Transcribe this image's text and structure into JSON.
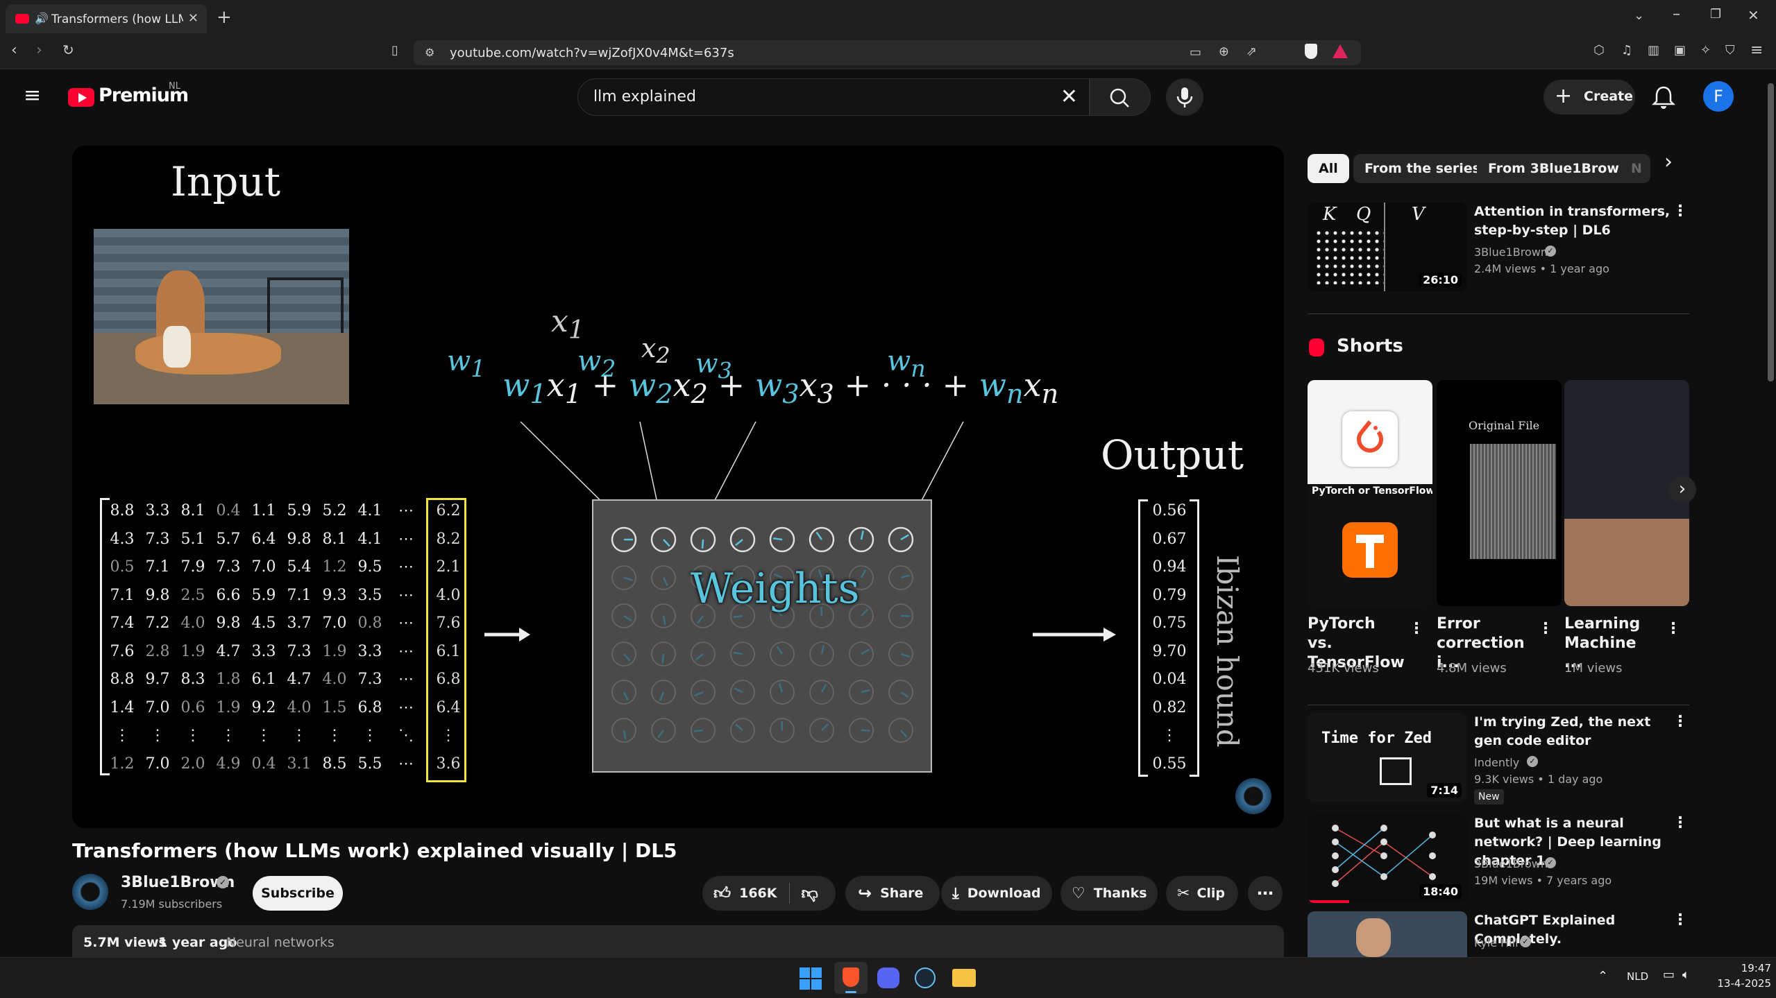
{
  "browser": {
    "tab_title": "Transformers (how LLMs wo",
    "url": "youtube.com/watch?v=wjZofJX0v4M&t=637s",
    "new_tab": "+",
    "icons": [
      "back-icon",
      "forward-icon",
      "reload-icon",
      "bookmark-icon",
      "site-settings-icon",
      "cast-icon",
      "zoom-icon",
      "share-icon",
      "brave-shield-icon",
      "brave-rewards-icon",
      "extensions-icon",
      "media-icon",
      "sidebar-icon",
      "wallet-icon",
      "leo-icon",
      "vpn-icon",
      "menu-icon"
    ]
  },
  "header": {
    "logo_text": "Premium",
    "region": "NL",
    "search_value": "llm explained",
    "create_label": "Create",
    "avatar_letter": "F"
  },
  "video": {
    "input_label": "Input",
    "output_label": "Output",
    "weights_label": "Weights",
    "class_label": "Ibizan hound",
    "formula_lines": [
      "x1",
      "x2",
      "x3",
      "w1",
      "w2",
      "w3",
      "wn"
    ],
    "input_matrix": [
      [
        "8.8",
        "3.3",
        "8.1",
        "0.4",
        "1.1",
        "5.9",
        "5.2",
        "4.1",
        "⋯",
        "6.2"
      ],
      [
        "4.3",
        "7.3",
        "5.1",
        "5.7",
        "6.4",
        "9.8",
        "8.1",
        "4.1",
        "⋯",
        "8.2"
      ],
      [
        "0.5",
        "7.1",
        "7.9",
        "7.3",
        "7.0",
        "5.4",
        "1.2",
        "9.5",
        "⋯",
        "2.1"
      ],
      [
        "7.1",
        "9.8",
        "2.5",
        "6.6",
        "5.9",
        "7.1",
        "9.3",
        "3.5",
        "⋯",
        "4.0"
      ],
      [
        "7.4",
        "7.2",
        "4.0",
        "9.8",
        "4.5",
        "3.7",
        "7.0",
        "0.8",
        "⋯",
        "7.6"
      ],
      [
        "7.6",
        "2.8",
        "1.9",
        "4.7",
        "3.3",
        "7.3",
        "1.9",
        "3.3",
        "⋯",
        "6.1"
      ],
      [
        "8.8",
        "9.7",
        "8.3",
        "1.8",
        "6.1",
        "4.7",
        "4.0",
        "7.3",
        "⋯",
        "6.8"
      ],
      [
        "1.4",
        "7.0",
        "0.6",
        "1.9",
        "9.2",
        "4.0",
        "1.5",
        "6.8",
        "⋯",
        "6.4"
      ],
      [
        "⋮",
        "⋮",
        "⋮",
        "⋮",
        "⋮",
        "⋮",
        "⋮",
        "⋮",
        "⋱",
        "⋮"
      ],
      [
        "1.2",
        "7.0",
        "2.0",
        "4.9",
        "0.4",
        "3.1",
        "8.5",
        "5.5",
        "⋯",
        "3.6"
      ]
    ],
    "output_vector": [
      "0.56",
      "0.67",
      "0.94",
      "0.79",
      "0.75",
      "9.70",
      "0.04",
      "0.82",
      "⋮",
      "0.55"
    ]
  },
  "watch": {
    "title": "Transformers (how LLMs work) explained visually | DL5",
    "channel": "3Blue1Brown",
    "subscribers": "7.19M subscribers",
    "subscribe_label": "Subscribe",
    "likes": "166K",
    "share_label": "Share",
    "download_label": "Download",
    "thanks_label": "Thanks",
    "clip_label": "Clip",
    "views": "5.7M views",
    "age": "1 year ago",
    "tag": "Neural networks"
  },
  "sidebar": {
    "chips": [
      "All",
      "From the series",
      "From 3Blue1Brown",
      "N"
    ],
    "shorts_heading": "Shorts",
    "videos": [
      {
        "title": "Attention in transformers, step-by-step | DL6",
        "channel": "3Blue1Brown",
        "meta": "2.4M views  • 1 year ago",
        "duration": "26:10"
      },
      {
        "title": "I'm trying Zed, the next gen code editor",
        "channel": "Indently",
        "meta": "9.3K views  • 1 day ago",
        "duration": "7:14",
        "badge": "New",
        "thumb_text": "Time for Zed"
      },
      {
        "title": "But what is a neural network? | Deep learning chapter 1",
        "channel": "3Blue1Brown",
        "meta": "19M views  • 7 years ago",
        "duration": "18:40"
      },
      {
        "title": "ChatGPT Explained Completely.",
        "channel": "Kyle Hill",
        "meta": "",
        "duration": ""
      }
    ],
    "shorts": [
      {
        "title": "PyTorch vs. TensorFlow",
        "views": "431K views",
        "thumb_text": "PyTorch or TensorFlow?"
      },
      {
        "title": "Error correction i...",
        "views": "4.8M views",
        "thumb_text": "Original File"
      },
      {
        "title": "Learning Machine ...",
        "views": "1M views"
      }
    ]
  },
  "taskbar": {
    "lang": "NLD",
    "time": "19:47",
    "date": "13-4-2025"
  },
  "colors": {
    "youtube_red": "#ff0033",
    "accent_blue": "#3ea6ff",
    "highlight_yellow": "#f5e342",
    "weights_blue": "#58c4dd"
  }
}
